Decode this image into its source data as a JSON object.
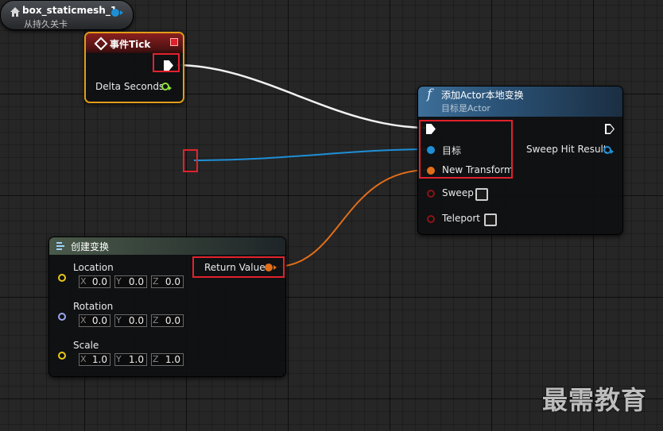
{
  "event_node": {
    "title": "事件Tick",
    "pin_delta_seconds": "Delta Seconds"
  },
  "variable_node": {
    "name": "box_staticmesh_1",
    "subtitle": "从持久关卡"
  },
  "function_node": {
    "icon": "f",
    "title": "添加Actor本地变换",
    "subtitle": "目标是Actor",
    "pins": {
      "target": "目标",
      "new_transform": "New Transform",
      "sweep": "Sweep",
      "teleport": "Teleport",
      "sweep_hit_result": "Sweep Hit Result"
    },
    "sweep_checked": false,
    "teleport_checked": false
  },
  "make_transform_node": {
    "title": "创建变换",
    "return_value": "Return Value",
    "rows": [
      {
        "label": "Location",
        "x": "0.0",
        "y": "0.0",
        "z": "0.0"
      },
      {
        "label": "Rotation",
        "x": "0.0",
        "y": "0.0",
        "z": "0.0"
      },
      {
        "label": "Scale",
        "x": "1.0",
        "y": "1.0",
        "z": "1.0"
      }
    ],
    "axis_labels": {
      "x": "X",
      "y": "Y",
      "z": "Z"
    }
  },
  "watermark": "最需教育",
  "colors": {
    "event_border": "#e29c19",
    "exec_wire": "#ffffff",
    "object_wire": "#1e8fd6",
    "transform_wire": "#e26e1a",
    "float_pin": "#8fe03a",
    "vector_pin": "#e8c81a",
    "rotator_pin": "#9aa7f0",
    "bool_pin": "#8a1414",
    "highlight": "#e2222c"
  },
  "icons": {
    "event": "diamond-icon",
    "variable": "home-icon",
    "function": "function-icon",
    "make_transform": "make-struct-icon"
  }
}
